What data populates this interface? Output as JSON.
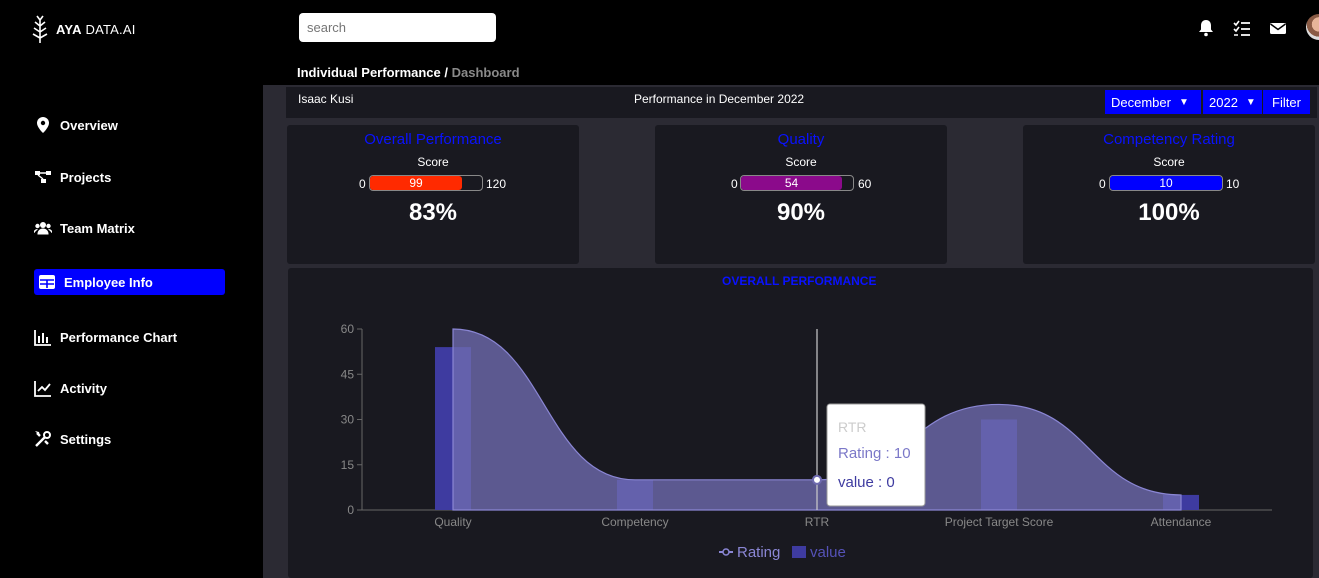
{
  "brand": {
    "name_bold": "AYA",
    "name_rest": " DATA.AI"
  },
  "sidebar": {
    "items": [
      {
        "label": "Overview",
        "icon": "location-pin-icon"
      },
      {
        "label": "Projects",
        "icon": "sitemap-icon"
      },
      {
        "label": "Team Matrix",
        "icon": "users-icon"
      },
      {
        "label": "Employee Info",
        "icon": "table-icon",
        "active": true
      },
      {
        "label": "Performance Chart",
        "icon": "bar-chart-icon"
      },
      {
        "label": "Activity",
        "icon": "line-chart-icon"
      },
      {
        "label": "Settings",
        "icon": "tools-icon"
      }
    ]
  },
  "header": {
    "search_placeholder": "search",
    "icons": [
      "bell-icon",
      "tasks-icon",
      "mail-icon",
      "avatar"
    ]
  },
  "breadcrumb": {
    "current": "Individual Performance",
    "separator": " / ",
    "page": "Dashboard"
  },
  "employee": {
    "name": "Isaac Kusi",
    "period_title": "Performance in December 2022"
  },
  "filters": {
    "month": "December",
    "year": "2022",
    "button": "Filter"
  },
  "cards": [
    {
      "title": "Overall Performance",
      "score_label": "Score",
      "min": "0",
      "max": "120",
      "value": "99",
      "fraction": 0.825,
      "percent": "83%",
      "color": "#ff2a00"
    },
    {
      "title": "Quality",
      "score_label": "Score",
      "min": "0",
      "max": "60",
      "value": "54",
      "fraction": 0.9,
      "percent": "90%",
      "color": "#8b0a8b"
    },
    {
      "title": "Competency Rating",
      "score_label": "Score",
      "min": "0",
      "max": "10",
      "value": "10",
      "fraction": 1.0,
      "percent": "100%",
      "color": "#0000ff"
    }
  ],
  "colors": {
    "accent": "#0000ff",
    "title_blue": "#0a12ff",
    "series_area": "#6f6bb0",
    "series_bar": "#3e3ba0"
  },
  "chart_data": {
    "type": "bar",
    "title": "OVERALL PERFORMANCE",
    "categories": [
      "Quality",
      "Competency",
      "RTR",
      "Project Target Score",
      "Attendance"
    ],
    "series": [
      {
        "name": "Rating",
        "type": "area",
        "values": [
          60,
          10,
          10,
          35,
          5
        ]
      },
      {
        "name": "value",
        "type": "bar",
        "values": [
          54,
          10,
          0,
          30,
          5
        ]
      }
    ],
    "ylim": [
      0,
      60
    ],
    "yticks": [
      "0",
      "15",
      "30",
      "45",
      "60"
    ],
    "legend": "bottom",
    "tooltip": {
      "title": "RTR",
      "line1": "Rating : 10",
      "line2": "value : 0"
    }
  }
}
